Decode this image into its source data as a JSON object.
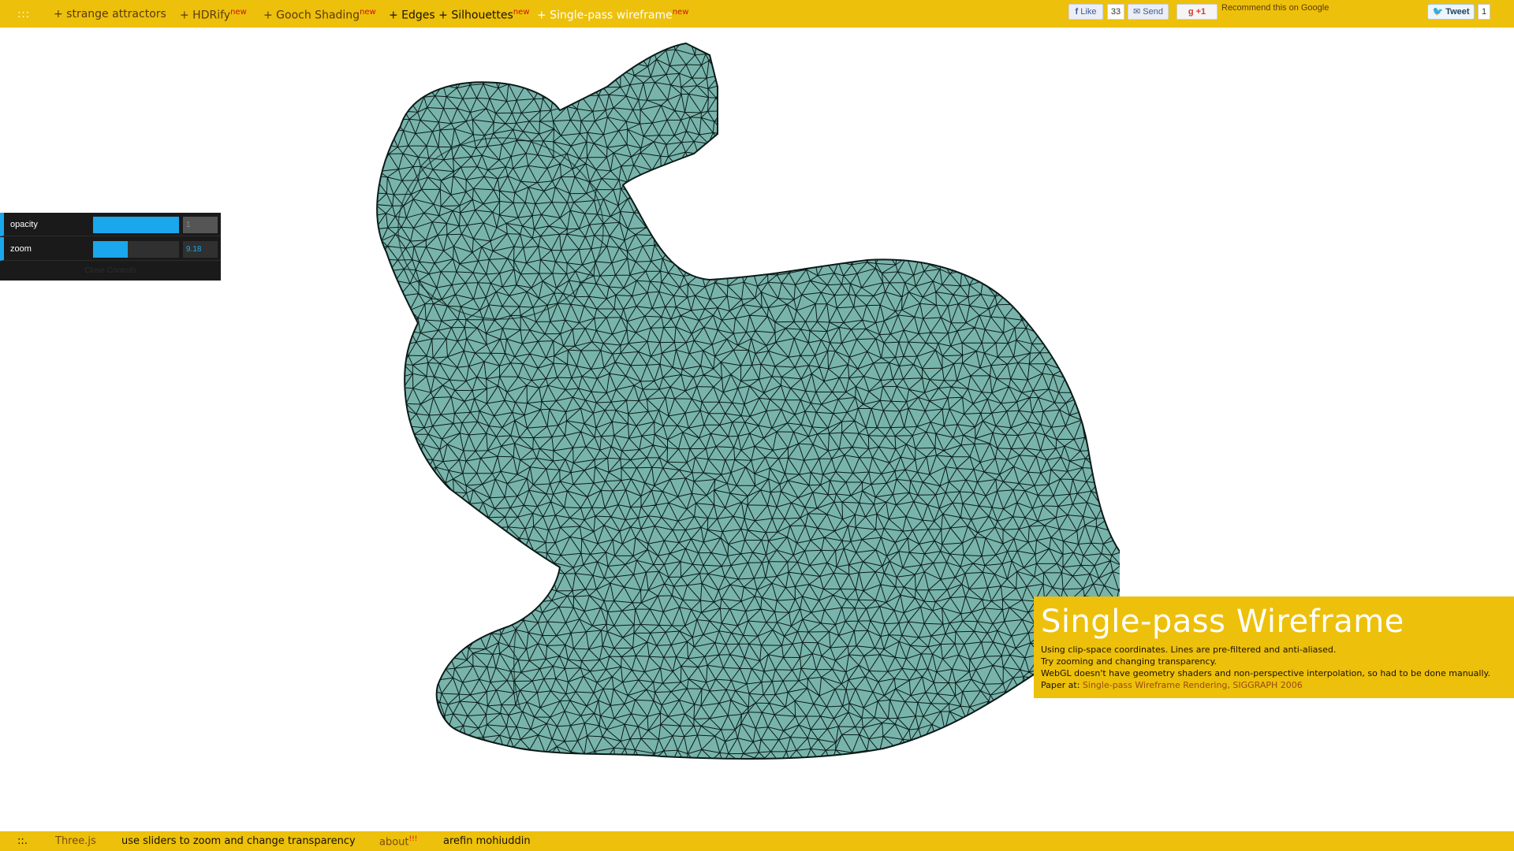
{
  "topbar": {
    "dots": ":::",
    "items": [
      {
        "label": "+ strange attractors",
        "sup": ""
      },
      {
        "label": "+ HDRify",
        "sup": "new"
      },
      {
        "label": "+ Gooch Shading",
        "sup": "new"
      },
      {
        "label": "+ Edges + Silhouettes",
        "sup": "new"
      },
      {
        "label": "+ Single-pass wireframe",
        "sup": "new"
      }
    ]
  },
  "social": {
    "fb_like_label": "Like",
    "fb_like_count": "33",
    "fb_send_label": "Send",
    "gplus_label": "+1",
    "gplus_recommend": "Recommend this on Google",
    "tweet_label": "Tweet",
    "tweet_count": "1"
  },
  "controls": {
    "opacity": {
      "label": "opacity",
      "value": "1",
      "fraction": 1.0
    },
    "zoom": {
      "label": "zoom",
      "value": "9.18",
      "fraction": 0.4
    },
    "close_label": "Close Controls"
  },
  "info": {
    "title": "Single-pass Wireframe",
    "line1": "Using clip-space coordinates. Lines are pre-filtered and anti-aliased.",
    "line2": "Try zooming and changing transparency.",
    "line3": "WebGL doesn't have geometry shaders and non-perspective interpolation, so had to be done manually.",
    "paper_prefix": "Paper at: ",
    "paper_link": "Single-pass Wireframe Rendering, SIGGRAPH 2006"
  },
  "bottombar": {
    "dots": "::.",
    "threejs": "Three.js",
    "hint": "use sliders to zoom and change transparency",
    "about": "about",
    "about_sup": "!!!",
    "author": "arefin mohiuddin"
  },
  "colors": {
    "bar": "#edc00b",
    "mesh_fill": "#78b4ab",
    "mesh_line": "#0a1a18",
    "slider": "#1aa7ec"
  }
}
